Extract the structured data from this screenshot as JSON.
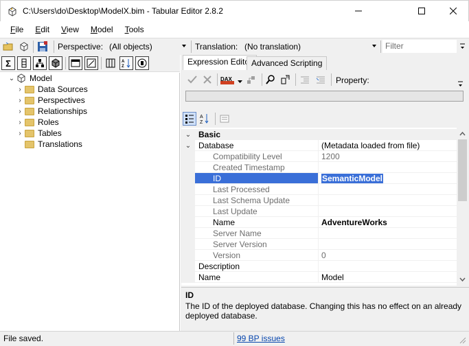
{
  "window": {
    "title": "C:\\Users\\do\\Desktop\\ModelX.bim - Tabular Editor 2.8.2",
    "minimize": "—",
    "maximize": "☐",
    "close": "✕"
  },
  "menu": {
    "items": [
      {
        "key": "F",
        "rest": "ile"
      },
      {
        "key": "E",
        "rest": "dit"
      },
      {
        "key": "V",
        "rest": "iew"
      },
      {
        "key": "M",
        "rest": "odel"
      },
      {
        "key": "T",
        "rest": "ools"
      }
    ]
  },
  "toolbar": {
    "perspective_label": "Perspective:",
    "perspective_value": "(All objects)",
    "translation_label": "Translation:",
    "translation_value": "(No translation)",
    "filter_placeholder": "Filter"
  },
  "tree": {
    "root": "Model",
    "children": [
      "Data Sources",
      "Perspectives",
      "Relationships",
      "Roles",
      "Tables",
      "Translations"
    ]
  },
  "tabs": [
    "Expression Editor",
    "Advanced Scripting"
  ],
  "expression_toolbar": {
    "dax_label": "DAX",
    "property_label": "Property:"
  },
  "property_grid": {
    "rows": [
      {
        "name": "Basic",
        "value": "",
        "type": "category",
        "chevron": "⌄"
      },
      {
        "name": "Database",
        "value": "(Metadata loaded from file)",
        "type": "group",
        "chevron": "⌄"
      },
      {
        "name": "Compatibility Level",
        "value": "1200",
        "type": "readonly"
      },
      {
        "name": "Created Timestamp",
        "value": "",
        "type": "readonly"
      },
      {
        "name": "ID",
        "value": "SemanticModel",
        "type": "selected"
      },
      {
        "name": "Last Processed",
        "value": "",
        "type": "readonly"
      },
      {
        "name": "Last Schema Update",
        "value": "",
        "type": "readonly"
      },
      {
        "name": "Last Update",
        "value": "",
        "type": "readonly"
      },
      {
        "name": "Name",
        "value": "AdventureWorks",
        "type": "editable"
      },
      {
        "name": "Server Name",
        "value": "",
        "type": "readonly"
      },
      {
        "name": "Server Version",
        "value": "",
        "type": "readonly"
      },
      {
        "name": "Version",
        "value": "0",
        "type": "readonly"
      },
      {
        "name": "Description",
        "value": "",
        "type": "plain"
      },
      {
        "name": "Name",
        "value": "Model",
        "type": "plain"
      }
    ]
  },
  "description": {
    "title": "ID",
    "text": "The ID of the deployed database. Changing this has no effect on an already deployed database."
  },
  "status": {
    "text": "File saved.",
    "bp_issues": "99 BP issues"
  }
}
